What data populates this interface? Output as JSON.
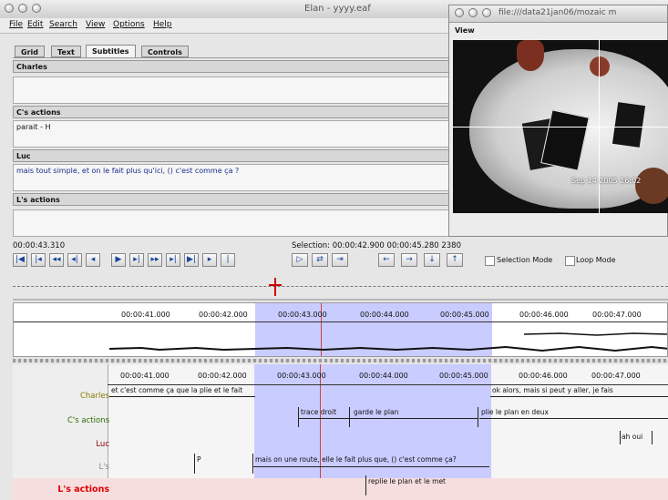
{
  "main_window": {
    "title": "Elan - yyyy.eaf",
    "menu": [
      "File",
      "Edit",
      "Search",
      "View",
      "Options",
      "Help"
    ],
    "tabs": [
      "Grid",
      "Text",
      "Subtitles",
      "Controls"
    ],
    "active_tab": "Subtitles",
    "subtitle_tiers": [
      {
        "name": "Charles",
        "text": ""
      },
      {
        "name": "C's actions",
        "text": "parait - H"
      },
      {
        "name": "Luc",
        "text": "mais tout simple, et on le fait plus qu'ici, () c'est comme ça ?"
      },
      {
        "name": "L's actions",
        "text": ""
      }
    ],
    "time_readout": "00:00:43.310",
    "selection_readout": "Selection: 00:00:42.900  00:00:45.280 2380",
    "selection_mode_label": "Selection Mode",
    "loop_mode_label": "Loop Mode",
    "waveform_ticks": [
      "00:00:41.000",
      "00:00:42.000",
      "00:00:43.000",
      "00:00:44.000",
      "00:00:45.000",
      "00:00:46.000",
      "00:00:47.000"
    ],
    "timeline_ticks": [
      "00:00:41.000",
      "00:00:42.000",
      "00:00:43.000",
      "00:00:44.000",
      "00:00:45.000",
      "00:00:46.000",
      "00:00:47.000"
    ],
    "tiers": [
      {
        "name": "Charles",
        "color": "#8a7a00",
        "annotations": [
          "et c'est comme ça que la plie et le fait",
          "ok alors, mais si peut y aller, je fais"
        ]
      },
      {
        "name": "C's actions",
        "color": "#2d6b00",
        "annotations": [
          "trace droit",
          "garde le plan",
          "plie le plan en deux"
        ]
      },
      {
        "name": "Luc",
        "color": "#8b0000",
        "annotations": [
          "ah oui"
        ]
      },
      {
        "name": "L's",
        "color": "#8a8a8a",
        "annotations": [
          "P",
          "mais on une route, elle le fait plus que, () c'est comme ça?"
        ]
      },
      {
        "name": "L's actions",
        "color": "#e00000",
        "annotations": [
          "replie le plan et le met"
        ]
      }
    ]
  },
  "video_window": {
    "title": "file:///data21jan06/mozaic m",
    "label": "View",
    "overlay_text": "Sep 14 2005 16:02"
  }
}
